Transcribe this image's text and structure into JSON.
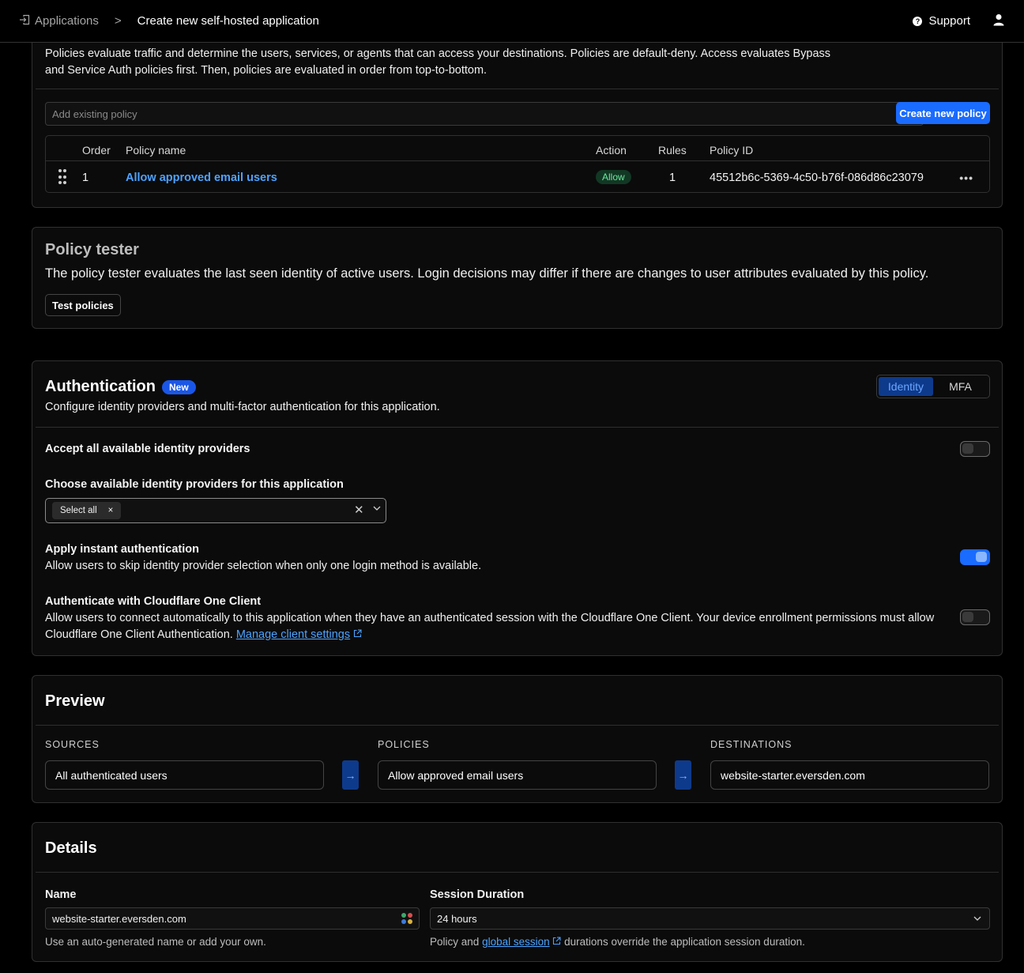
{
  "colors": {
    "accent": "#1a6bff",
    "link": "#4da3ff",
    "allow_badge": "#6ee7a0"
  },
  "topbar": {
    "breadcrumb_root": "Applications",
    "breadcrumb_separator": ">",
    "breadcrumb_current": "Create new self-hosted application",
    "support_label": "Support",
    "icons": [
      "sign-in-icon",
      "help-circle-icon",
      "user-icon"
    ]
  },
  "policies": {
    "description": "Policies evaluate traffic and determine the users, services, or agents that can access your destinations. Policies are default-deny. Access evaluates Bypass and Service Auth policies first. Then, policies are evaluated in order from top-to-bottom.",
    "select_placeholder": "Add existing policy",
    "create_button": "Create new policy",
    "columns": [
      "Order",
      "Policy name",
      "Action",
      "Rules",
      "Policy ID"
    ],
    "rows": [
      {
        "order": "1",
        "name": "Allow approved email users",
        "action": "Allow",
        "rules": "1",
        "policy_id": "45512b6c-5369-4c50-b76f-086d86c23079"
      }
    ],
    "row_menu_glyph": "•••"
  },
  "tester": {
    "title": "Policy tester",
    "description": "The policy tester evaluates the last seen identity of active users. Login decisions may differ if there are changes to user attributes evaluated by this policy.",
    "button": "Test policies"
  },
  "auth": {
    "title": "Authentication",
    "badge": "New",
    "description": "Configure identity providers and multi-factor authentication for this application.",
    "tabs": [
      "Identity",
      "MFA"
    ],
    "accept_all_label": "Accept all available identity providers",
    "accept_all_on": false,
    "choose_label": "Choose available identity providers for this application",
    "chip_label": "Select all",
    "chip_remove": "×",
    "clear_glyph": "✕",
    "instant_title": "Apply instant authentication",
    "instant_desc": "Allow users to skip identity provider selection when only one login method is available.",
    "instant_on": true,
    "client_title": "Authenticate with Cloudflare One Client",
    "client_desc": "Allow users to connect automatically to this application when they have an authenticated session with the Cloudflare One Client. Your device enrollment permissions must allow Cloudflare One Client Authentication.",
    "client_link": "Manage client settings",
    "client_on": false
  },
  "preview": {
    "title": "Preview",
    "sources_label": "SOURCES",
    "policies_label": "POLICIES",
    "destinations_label": "DESTINATIONS",
    "source": "All authenticated users",
    "policy": "Allow approved email users",
    "destination": "website-starter.eversden.com",
    "arrow_glyph": "→"
  },
  "details": {
    "title": "Details",
    "name_label": "Name",
    "name_value": "website-starter.eversden.com",
    "name_hint": "Use an auto-generated name or add your own.",
    "duration_label": "Session Duration",
    "duration_value": "24 hours",
    "duration_hint_pre": "Policy and",
    "duration_hint_link": "global session",
    "duration_hint_post": "durations override the application session duration."
  }
}
